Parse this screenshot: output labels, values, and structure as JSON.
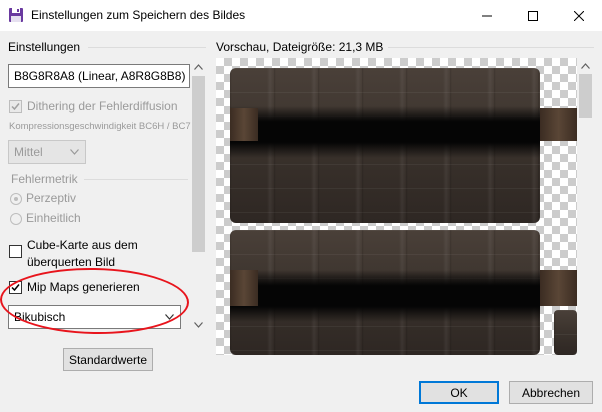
{
  "window": {
    "title": "Einstellungen zum Speichern des Bildes",
    "icon": "floppy-disk-icon",
    "minimize_icon": "minimize-icon",
    "maximize_icon": "maximize-icon",
    "close_icon": "close-icon"
  },
  "settings": {
    "group_label": "Einstellungen",
    "format_value": "B8G8R8A8 (Linear, A8R8G8B8)",
    "dithering_label": "Dithering der Fehlerdiffusion",
    "dithering_checked": true,
    "compression_speed_label": "Kompressionsgeschwindigkeit BC6H / BC7",
    "compression_speed_value": "Mittel",
    "error_metric_label": "Fehlermetrik",
    "error_metric_options": [
      "Perzeptiv",
      "Einheitlich"
    ],
    "error_metric_selected": "Perzeptiv",
    "cubemap_label_line1": "Cube-Karte aus dem",
    "cubemap_label_line2": "überquerten Bild",
    "cubemap_checked": false,
    "mipmaps_label": "Mip Maps generieren",
    "mipmaps_checked": true,
    "mipmap_filter_value": "Bikubisch",
    "defaults_button": "Standardwerte"
  },
  "preview": {
    "label": "Vorschau, Dateigröße: 21,3 MB"
  },
  "footer": {
    "ok_label": "OK",
    "cancel_label": "Abbrechen"
  },
  "colors": {
    "accent": "#0078d7",
    "annotation_red": "#e8141c"
  }
}
